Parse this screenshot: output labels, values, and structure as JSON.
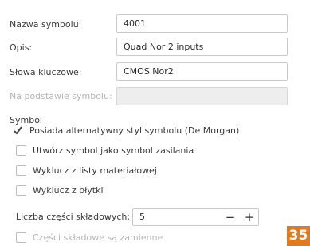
{
  "form": {
    "symbol_name_label": "Nazwa symbolu:",
    "symbol_name_value": "4001",
    "description_label": "Opis:",
    "description_value": "Quad Nor 2 inputs",
    "keywords_label": "Słowa kluczowe:",
    "keywords_value": "CMOS Nor2",
    "based_on_label": "Na podstawie symbolu:",
    "based_on_value": ""
  },
  "symbol_section": {
    "title": "Symbol",
    "options": [
      {
        "label": "Posiada alternatywny styl symbolu (De Morgan)",
        "checked": true
      },
      {
        "label": "Utwórz symbol jako symbol zasilania",
        "checked": false
      },
      {
        "label": "Wyklucz z listy materiałowej",
        "checked": false
      },
      {
        "label": "Wyklucz z płytki",
        "checked": false
      }
    ]
  },
  "units": {
    "count_label": "Liczba części składowych:",
    "count_value": "5",
    "minus_label": "−",
    "plus_label": "+",
    "interchangeable_label": "Części składowe są zamienne",
    "interchangeable_checked": false
  },
  "page_badge": "35",
  "colors": {
    "badge": "#e07a1f",
    "check": "#444444"
  }
}
